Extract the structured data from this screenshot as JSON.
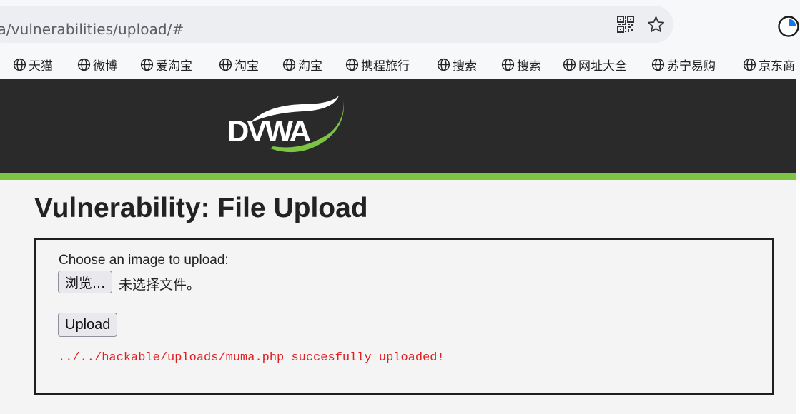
{
  "browser": {
    "url": "wa/vulnerabilities/upload/#",
    "bookmarks": [
      {
        "label": "天猫"
      },
      {
        "label": "微博"
      },
      {
        "label": "爱淘宝"
      },
      {
        "label": "淘宝"
      },
      {
        "label": "淘宝"
      },
      {
        "label": "携程旅行"
      },
      {
        "label": "搜索"
      },
      {
        "label": "搜索"
      },
      {
        "label": "网址大全"
      },
      {
        "label": "苏宁易购"
      },
      {
        "label": "京东商"
      }
    ],
    "icons": [
      "qr-code-icon",
      "star-icon",
      "profile-icon",
      "globe-icon"
    ]
  },
  "header": {
    "logo_text": "DVWA",
    "colors": {
      "background": "#2a2a2a",
      "accent": "#7cc443"
    }
  },
  "main": {
    "title": "Vulnerability: File Upload",
    "form": {
      "prompt": "Choose an image to upload:",
      "browse_label": "浏览...",
      "no_file_label": "未选择文件。",
      "upload_label": "Upload",
      "result_message": "../../hackable/uploads/muma.php succesfully uploaded!",
      "result_color": "#e02020"
    }
  }
}
